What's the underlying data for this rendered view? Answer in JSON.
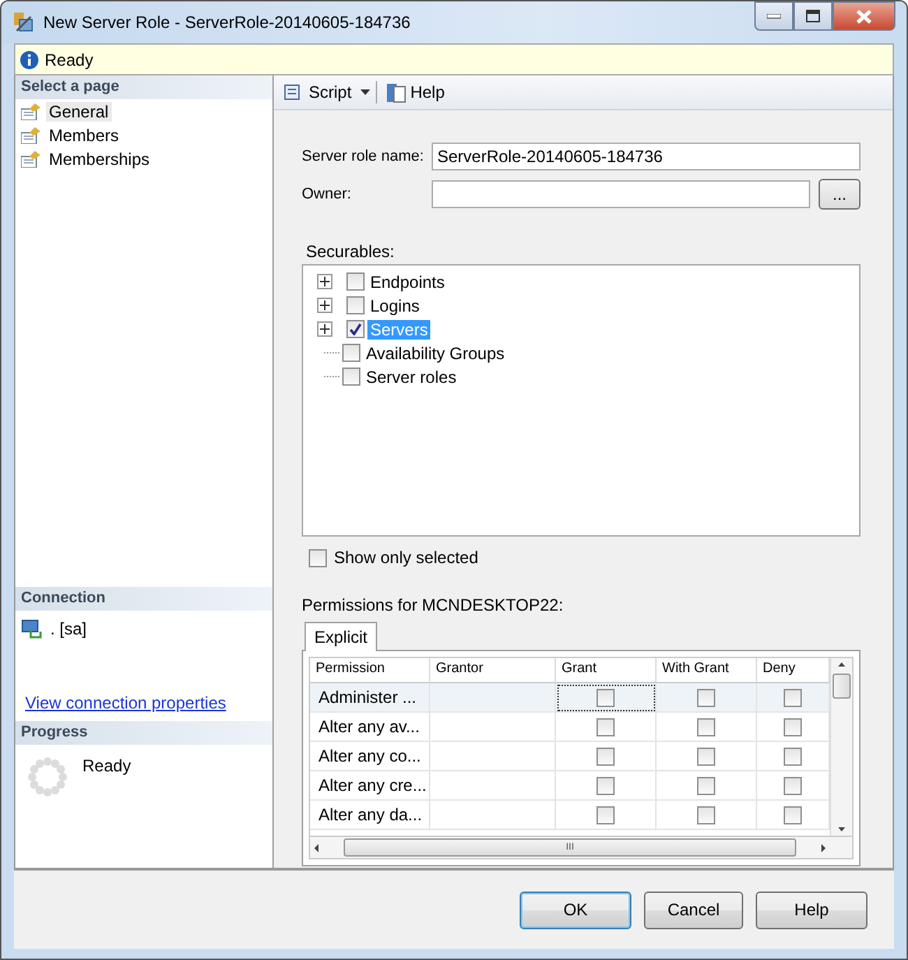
{
  "window": {
    "title": "New Server Role - ServerRole-20140605-184736"
  },
  "status": {
    "text": "Ready"
  },
  "sidebar": {
    "header": "Select a page",
    "items": [
      {
        "label": "General",
        "selected": true
      },
      {
        "label": "Members",
        "selected": false
      },
      {
        "label": "Memberships",
        "selected": false
      }
    ]
  },
  "connection": {
    "header": "Connection",
    "server": ". [sa]",
    "link": "View connection properties"
  },
  "progress": {
    "header": "Progress",
    "text": "Ready"
  },
  "toolbar": {
    "script": "Script",
    "help": "Help"
  },
  "form": {
    "name_label": "Server role name:",
    "name_value": "ServerRole-20140605-184736",
    "owner_label": "Owner:",
    "browse": "..."
  },
  "securables": {
    "label": "Securables:",
    "items": [
      {
        "label": "Endpoints",
        "expandable": true,
        "checked": false,
        "selected": false
      },
      {
        "label": "Logins",
        "expandable": true,
        "checked": false,
        "selected": false
      },
      {
        "label": "Servers",
        "expandable": true,
        "checked": true,
        "selected": true
      },
      {
        "label": "Availability Groups",
        "expandable": false,
        "checked": false,
        "selected": false
      },
      {
        "label": "Server roles",
        "expandable": false,
        "checked": false,
        "selected": false
      }
    ]
  },
  "show_only_selected": {
    "label": "Show only selected",
    "checked": false
  },
  "permissions": {
    "label": "Permissions for MCNDESKTOP22:",
    "tab": "Explicit",
    "columns": [
      "Permission",
      "Grantor",
      "Grant",
      "With Grant",
      "Deny"
    ],
    "rows": [
      {
        "permission": "Administer ...",
        "grant": false,
        "with_grant": false,
        "deny": false,
        "selected": true
      },
      {
        "permission": "Alter any av...",
        "grant": false,
        "with_grant": false,
        "deny": false,
        "selected": false
      },
      {
        "permission": "Alter any co...",
        "grant": false,
        "with_grant": false,
        "deny": false,
        "selected": false
      },
      {
        "permission": "Alter any cre...",
        "grant": false,
        "with_grant": false,
        "deny": false,
        "selected": false
      },
      {
        "permission": "Alter any da...",
        "grant": false,
        "with_grant": false,
        "deny": false,
        "selected": false
      }
    ],
    "hscroll_mark": "III"
  },
  "buttons": [
    "OK",
    "Cancel",
    "Help"
  ]
}
